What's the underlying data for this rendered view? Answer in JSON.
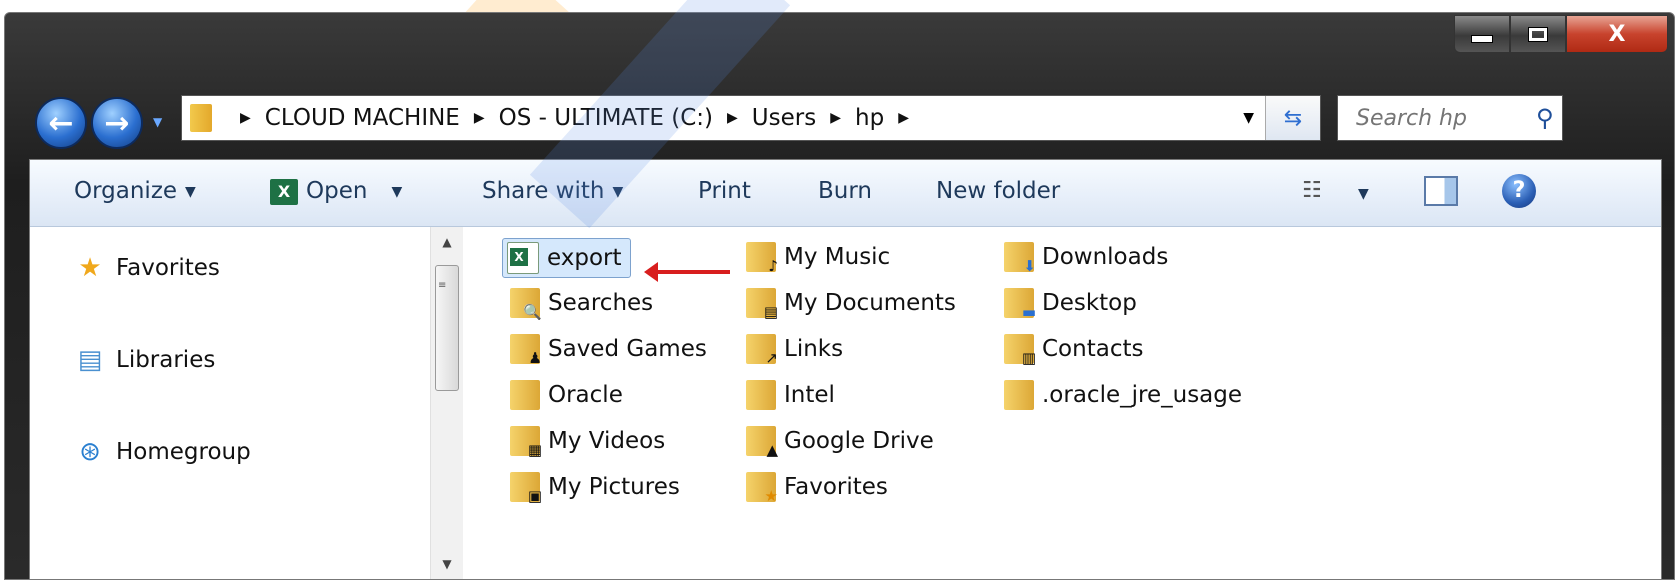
{
  "window": {
    "caption_close": "X"
  },
  "navigation": {
    "back_symbol": "←",
    "forward_symbol": "→",
    "breadcrumbs": [
      "CLOUD  MACHINE",
      "OS - ULTIMATE (C:)",
      "Users",
      "hp"
    ],
    "search_placeholder": "Search hp"
  },
  "toolbar": {
    "organize": "Organize",
    "open": "Open",
    "share_with": "Share with",
    "print": "Print",
    "burn": "Burn",
    "new_folder": "New folder",
    "help": "?"
  },
  "nav_pane": {
    "items": [
      {
        "label": "Favorites",
        "icon": "star-icon"
      },
      {
        "label": "Libraries",
        "icon": "libraries-icon"
      },
      {
        "label": "Homegroup",
        "icon": "homegroup-icon"
      }
    ]
  },
  "files": {
    "col1": [
      "export",
      "Searches",
      "Saved Games",
      "Oracle",
      "My Videos",
      "My Pictures"
    ],
    "col2": [
      "My Music",
      "My Documents",
      "Links",
      "Intel",
      "Google Drive",
      "Favorites"
    ],
    "col3": [
      "Downloads",
      "Desktop",
      "Contacts",
      ".oracle_jre_usage"
    ]
  },
  "colors": {
    "accent": "#2b6fd0",
    "selection": "#d5e8fc",
    "excel_green": "#1e7145",
    "annotation_arrow": "#d81e1e"
  }
}
